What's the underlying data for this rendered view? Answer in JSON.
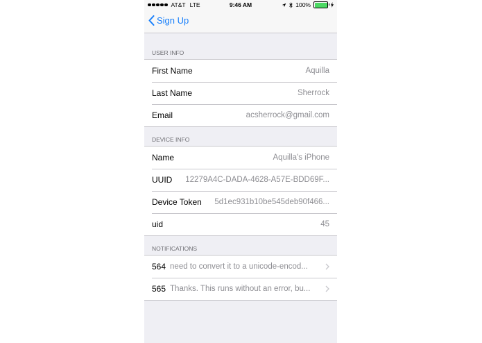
{
  "status_bar": {
    "carrier": "AT&T",
    "network": "LTE",
    "time": "9:46 AM",
    "battery": "100%",
    "battery_level": 1.0,
    "battery_color": "#4cd964"
  },
  "nav": {
    "back_label": "Sign Up",
    "accent_color": "#157efb"
  },
  "sections": {
    "user_info": {
      "header": "USER INFO",
      "rows": [
        {
          "label": "First Name",
          "value": "Aquilla"
        },
        {
          "label": "Last Name",
          "value": "Sherrock"
        },
        {
          "label": "Email",
          "value": "acsherrock@gmail.com"
        }
      ]
    },
    "device_info": {
      "header": "DEVICE INFO",
      "rows": [
        {
          "label": "Name",
          "value": "Aquilla's iPhone"
        },
        {
          "label": "UUID",
          "value": "12279A4C-DADA-4628-A57E-BDD69F..."
        },
        {
          "label": "Device Token",
          "value": "5d1ec931b10be545deb90f466..."
        },
        {
          "label": "uid",
          "value": "45"
        }
      ]
    },
    "notifications": {
      "header": "NOTIFICATIONS",
      "rows": [
        {
          "label": "564",
          "value": "need to convert it to a unicode-encod..."
        },
        {
          "label": "565",
          "value": "Thanks. This runs without an error, bu..."
        }
      ]
    }
  }
}
